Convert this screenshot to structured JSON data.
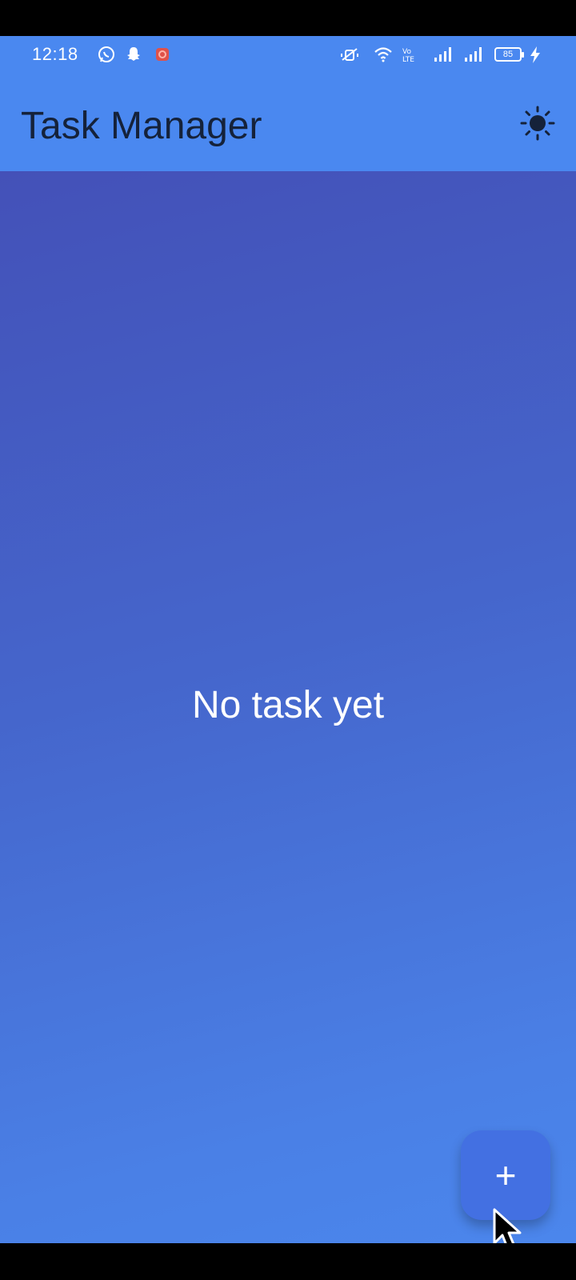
{
  "status_bar": {
    "time": "12:18",
    "battery": "85",
    "icons": [
      "whatsapp-icon",
      "snapchat-icon",
      "notification-app-icon",
      "mute-icon",
      "wifi-icon",
      "volte-icon",
      "signal-icon",
      "signal-icon",
      "charging-icon"
    ]
  },
  "app_bar": {
    "title": "Task Manager",
    "theme_icon": "sun-icon"
  },
  "main": {
    "empty_message": "No task yet"
  },
  "fab": {
    "label": "+"
  },
  "colors": {
    "app_bar": "#4a88f0",
    "title_text": "#15223a",
    "fab": "#4370e2",
    "gradient_top": "#4451b8",
    "gradient_bottom": "#4b86ec"
  }
}
